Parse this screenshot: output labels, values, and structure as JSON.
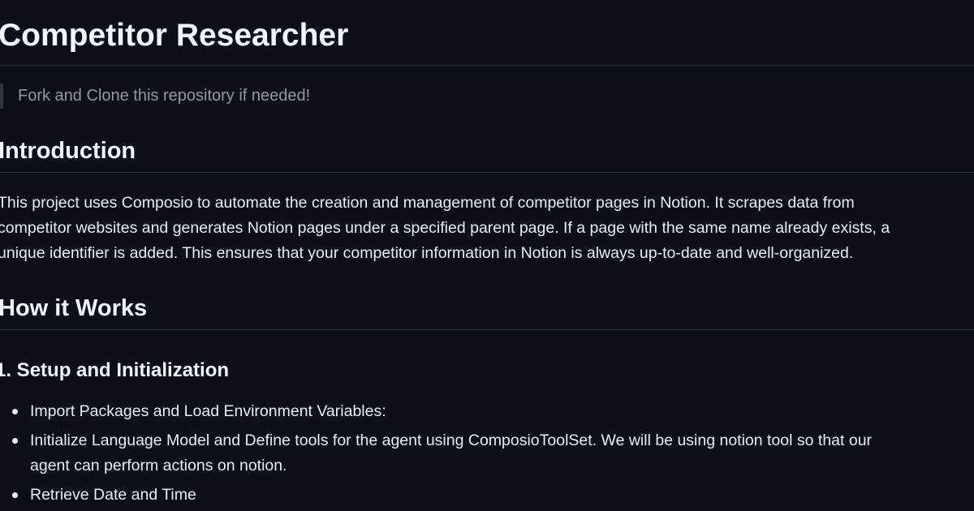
{
  "readme": {
    "title": "Competitor Researcher",
    "note": "Fork and Clone this repository if needed!",
    "introduction": {
      "heading": "Introduction",
      "lines": [
        "This project uses Composio to automate the creation and management of competitor pages in Notion. It scrapes data from",
        "competitor websites and generates Notion pages under a specified parent page. If a page with the same name already exists, a",
        "unique identifier is added. This ensures that your competitor information in Notion is always up-to-date and well-organized."
      ]
    },
    "how_it_works": {
      "heading": "How it Works",
      "setup": {
        "heading": "1. Setup and Initialization",
        "items": [
          {
            "lines": [
              "Import Packages and Load Environment Variables:"
            ]
          },
          {
            "lines": [
              "Initialize Language Model and Define tools for the agent using ComposioToolSet. We will be using notion tool so that our",
              "agent can perform actions on notion."
            ]
          },
          {
            "lines": [
              "Retrieve Date and Time"
            ]
          }
        ]
      }
    }
  },
  "colors": {
    "background": "#0d1117",
    "text": "#e6edf3",
    "heading": "#f0f6fc",
    "muted": "#9198a1",
    "border": "#30363d"
  }
}
